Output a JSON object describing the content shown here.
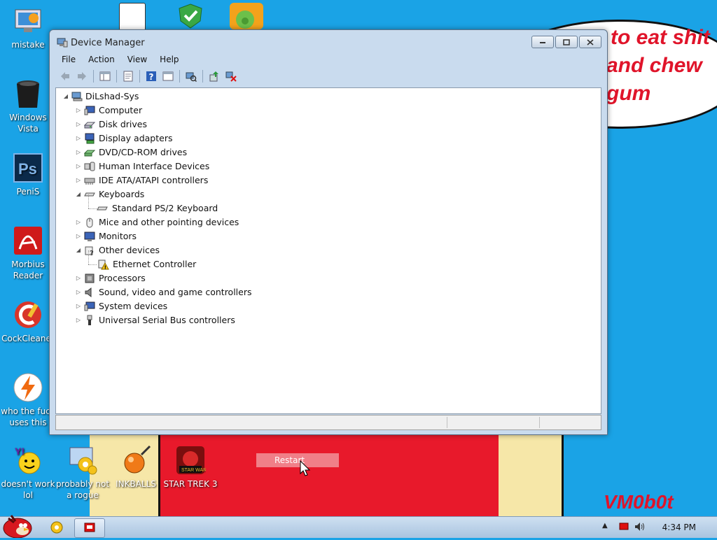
{
  "wallpaper": {
    "bubble_lines": [
      "to eat shit",
      "and chew",
      "gum"
    ],
    "signature": "VM0b0t",
    "tooltip": "Restart"
  },
  "desktop_icons": [
    {
      "label": "mistake",
      "icon": "monitor-icon"
    },
    {
      "label": "Windows Vista",
      "icon": "trash-bin-icon"
    },
    {
      "label": "PeniS",
      "icon": "photoshop-icon"
    },
    {
      "label": "Morbius Reader",
      "icon": "pdf-reader-icon"
    },
    {
      "label": "CockCleaner",
      "icon": "cleaner-icon"
    },
    {
      "label": "who the fuck uses this",
      "icon": "lightning-icon"
    },
    {
      "label": "doesn't work lol",
      "icon": "yahoo-messenger-icon"
    },
    {
      "label": "probably not a rogue",
      "icon": "settings-gears-icon"
    },
    {
      "label": "INKBALLS",
      "icon": "inkball-icon"
    },
    {
      "label": "STAR TREK 3",
      "icon": "star-wars-game-icon"
    }
  ],
  "window": {
    "title": "Device Manager",
    "menu": [
      "File",
      "Action",
      "View",
      "Help"
    ],
    "toolbar": [
      "back-arrow-icon",
      "forward-arrow-icon",
      "show-hide-tree-icon",
      "properties-icon",
      "help-icon",
      "view-icon",
      "scan-hardware-icon",
      "update-driver-icon",
      "uninstall-icon"
    ],
    "root": "DiLshad-Sys",
    "tree": [
      {
        "label": "Computer",
        "expanded": false,
        "icon": "computer-icon"
      },
      {
        "label": "Disk drives",
        "expanded": false,
        "icon": "disk-drive-icon"
      },
      {
        "label": "Display adapters",
        "expanded": false,
        "icon": "display-adapter-icon"
      },
      {
        "label": "DVD/CD-ROM drives",
        "expanded": false,
        "icon": "dvd-drive-icon"
      },
      {
        "label": "Human Interface Devices",
        "expanded": false,
        "icon": "hid-icon"
      },
      {
        "label": "IDE ATA/ATAPI controllers",
        "expanded": false,
        "icon": "ide-controller-icon"
      },
      {
        "label": "Keyboards",
        "expanded": true,
        "icon": "keyboard-icon",
        "children": [
          {
            "label": "Standard PS/2 Keyboard",
            "icon": "keyboard-icon"
          }
        ]
      },
      {
        "label": "Mice and other pointing devices",
        "expanded": false,
        "icon": "mouse-icon"
      },
      {
        "label": "Monitors",
        "expanded": false,
        "icon": "monitor-icon"
      },
      {
        "label": "Other devices",
        "expanded": true,
        "icon": "unknown-device-icon",
        "children": [
          {
            "label": "Ethernet Controller",
            "icon": "warning-device-icon"
          }
        ]
      },
      {
        "label": "Processors",
        "expanded": false,
        "icon": "processor-icon"
      },
      {
        "label": "Sound, video and game controllers",
        "expanded": false,
        "icon": "speaker-icon"
      },
      {
        "label": "System devices",
        "expanded": false,
        "icon": "system-devices-icon"
      },
      {
        "label": "Universal Serial Bus controllers",
        "expanded": false,
        "icon": "usb-icon"
      }
    ]
  },
  "taskbar": {
    "start_icon": "angry-bird-start-icon",
    "clock": "4:34 PM",
    "tray": [
      "show-hidden-icons-arrow",
      "network-icon",
      "volume-icon"
    ]
  }
}
